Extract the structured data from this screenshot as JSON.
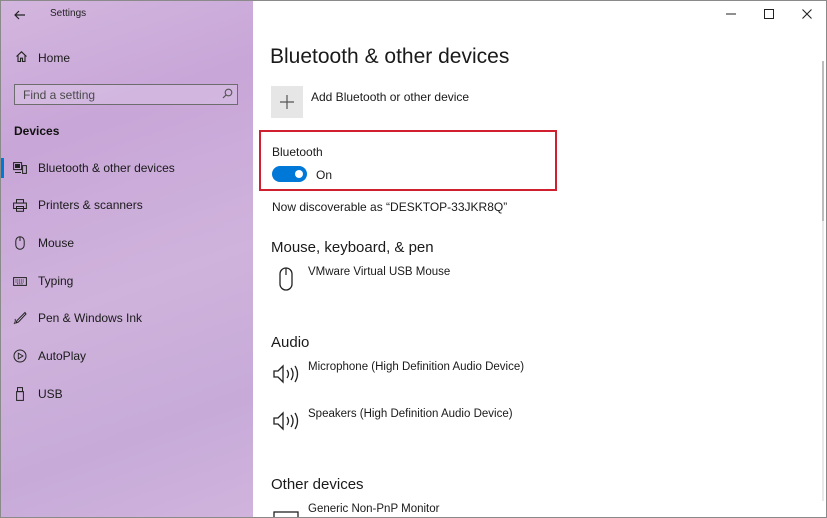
{
  "window": {
    "title": "Settings"
  },
  "icons": {
    "back": "back-arrow-icon",
    "home": "home-icon",
    "search": "search-icon",
    "minimize": "minimize-icon",
    "maximize": "maximize-icon",
    "close": "close-icon"
  },
  "sidebar": {
    "home_label": "Home",
    "search_placeholder": "Find a setting",
    "section_label": "Devices",
    "items": [
      {
        "label": "Bluetooth & other devices",
        "icon": "bluetooth-devices-icon",
        "active": true
      },
      {
        "label": "Printers & scanners",
        "icon": "printer-icon",
        "active": false
      },
      {
        "label": "Mouse",
        "icon": "mouse-icon",
        "active": false
      },
      {
        "label": "Typing",
        "icon": "keyboard-icon",
        "active": false
      },
      {
        "label": "Pen & Windows Ink",
        "icon": "pen-icon",
        "active": false
      },
      {
        "label": "AutoPlay",
        "icon": "autoplay-icon",
        "active": false
      },
      {
        "label": "USB",
        "icon": "usb-icon",
        "active": false
      }
    ]
  },
  "main": {
    "title": "Bluetooth & other devices",
    "add_device_label": "Add Bluetooth or other device",
    "bluetooth": {
      "label": "Bluetooth",
      "state_text": "On",
      "on": true
    },
    "discoverable_text": "Now discoverable as “DESKTOP-33JKR8Q”",
    "groups": [
      {
        "title": "Mouse, keyboard, & pen",
        "devices": [
          {
            "name": "VMware Virtual USB Mouse",
            "icon": "mouse-icon"
          }
        ]
      },
      {
        "title": "Audio",
        "devices": [
          {
            "name": "Microphone (High Definition Audio Device)",
            "icon": "speaker-icon"
          },
          {
            "name": "Speakers (High Definition Audio Device)",
            "icon": "speaker-icon"
          }
        ]
      },
      {
        "title": "Other devices",
        "devices": [
          {
            "name": "Generic Non-PnP Monitor",
            "icon": "monitor-icon"
          }
        ]
      }
    ]
  },
  "colors": {
    "accent": "#0078d7",
    "highlight": "#d01f2e",
    "sidebar_tint": "#c9a9d8"
  }
}
